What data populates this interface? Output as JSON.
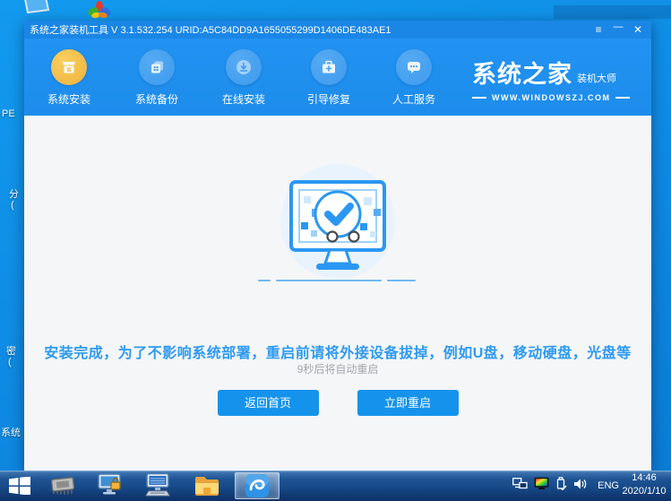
{
  "desktop": {
    "fragments": [
      "PE",
      "分",
      "(",
      "密",
      "(",
      "系统"
    ]
  },
  "window": {
    "title": "系统之家装机工具 V 3.1.532.254 URID:A5C84DD9A1655055299D1406DE483AE1",
    "controls": {
      "menu": "≡",
      "minimize": "—",
      "close": "✕"
    },
    "nav": {
      "tabs": [
        {
          "label": "系统安装",
          "active": true
        },
        {
          "label": "系统备份",
          "active": false
        },
        {
          "label": "在线安装",
          "active": false
        },
        {
          "label": "引导修复",
          "active": false
        },
        {
          "label": "人工服务",
          "active": false
        }
      ]
    },
    "brand": {
      "name": "系统之家",
      "tagline": "装机大师",
      "site": "WWW.WINDOWSZJ.COM"
    },
    "main": {
      "message": "安装完成，为了不影响系统部署，重启前请将外接设备拔掉，例如U盘，移动硬盘，光盘等",
      "countdown": "9秒后将自动重启",
      "home_button": "返回首页",
      "restart_button": "立即重启"
    }
  },
  "taskbar": {
    "tray": {
      "language": "ENG",
      "time": "14:46",
      "date": "2020/1/10"
    }
  },
  "colors": {
    "titlebar_blue": "#1A86E6",
    "nav_blue": "#2092F0",
    "active_tab_yellow": "#F2BC45",
    "button_blue": "#1593EC",
    "message_blue": "#2E9AF1",
    "content_bg": "#F4F6F8"
  }
}
